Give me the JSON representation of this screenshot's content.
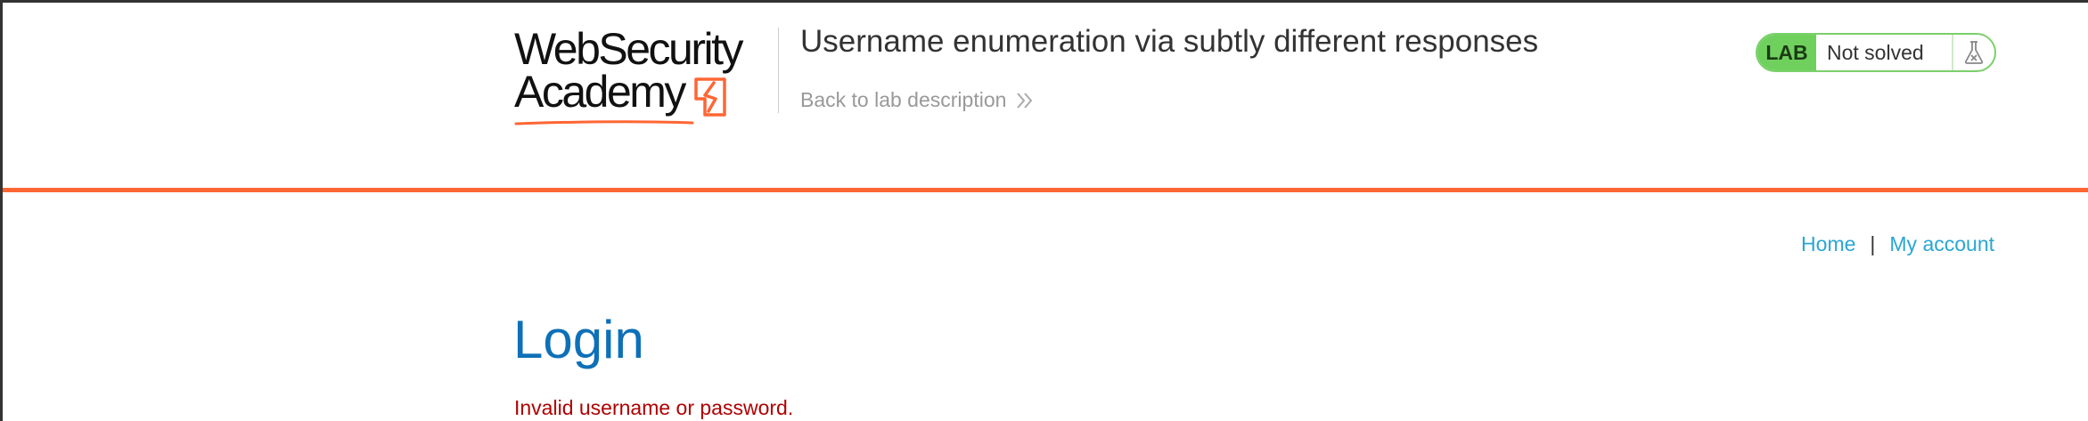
{
  "header": {
    "logo": {
      "line1": "WebSecurity",
      "line2": "Academy",
      "colors": {
        "text": "#111111",
        "accent": "#ff6633"
      }
    },
    "lab_title": "Username enumeration via subtly different responses",
    "back_link": {
      "label": "Back to lab description",
      "icon": "double-chevron-right-icon"
    },
    "rule_color": "#ff6633"
  },
  "lab_status": {
    "badge": "LAB",
    "state": "Not solved",
    "icon": "flask-icon",
    "colors": {
      "badge_bg": "#70d05e",
      "border": "#7bd06a"
    }
  },
  "nav": {
    "home": "Home",
    "separator": "|",
    "account": "My account",
    "link_color": "#2aa6d3"
  },
  "main": {
    "title": "Login",
    "title_color": "#0d70b8",
    "error": "Invalid username or password.",
    "error_color": "#b00000"
  }
}
